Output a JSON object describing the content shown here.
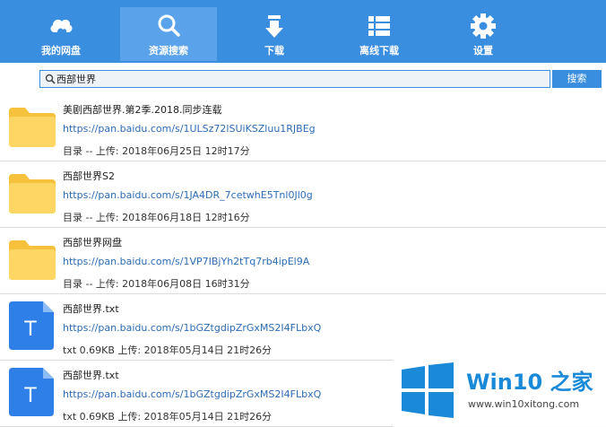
{
  "nav": [
    {
      "label": "我的网盘",
      "icon": "cloud-icon"
    },
    {
      "label": "资源搜索",
      "icon": "search-icon"
    },
    {
      "label": "下载",
      "icon": "download-arrow-icon"
    },
    {
      "label": "离线下载",
      "icon": "list-icon"
    },
    {
      "label": "设置",
      "icon": "gear-icon"
    }
  ],
  "search": {
    "value": "西部世界",
    "button": "搜索"
  },
  "results": [
    {
      "title": "美剧西部世界.第2季.2018.同步连载",
      "link": "https://pan.baidu.com/s/1ULSz72lSUiKSZluu1RJBEg",
      "meta": "目录 -- 上传: 2018年06月25日 12时17分",
      "type": "folder"
    },
    {
      "title": "西部世界S2",
      "link": "https://pan.baidu.com/s/1JA4DR_7cetwhE5Tnl0Jl0g",
      "meta": "目录 -- 上传: 2018年06月18日 12时16分",
      "type": "folder"
    },
    {
      "title": "西部世界网盘",
      "link": "https://pan.baidu.com/s/1VP7IBjYh2tTq7rb4ipEl9A",
      "meta": "目录 -- 上传: 2018年06月08日 16时31分",
      "type": "folder"
    },
    {
      "title": "西部世界.txt",
      "link": "https://pan.baidu.com/s/1bGZtgdipZrGxMS2I4FLbxQ",
      "meta": "txt 0.69KB 上传: 2018年05月14日 21时26分",
      "type": "text-file"
    },
    {
      "title": "西部世界.txt",
      "link": "https://pan.baidu.com/s/1bGZtgdipZrGxMS2I4FLbxQ",
      "meta": "txt 0.69KB 上传: 2018年05月14日 21时26分",
      "type": "text-file"
    }
  ],
  "file_icon_letter": "T",
  "watermark": {
    "title": "Win10 之家",
    "url": "www.win10xitong.com"
  },
  "colors": {
    "accent": "#3a8ee0",
    "folder": "#fcd35c",
    "txt": "#2f7fe8",
    "link": "#2d6cb5"
  }
}
